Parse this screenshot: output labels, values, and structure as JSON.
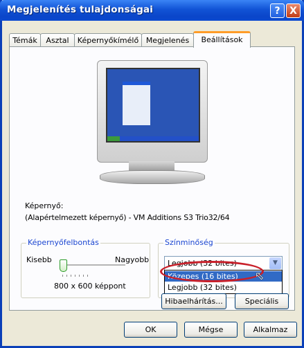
{
  "window": {
    "title": "Megjelenítés tulajdonságai"
  },
  "titlebar_buttons": {
    "help": "?",
    "close": "X"
  },
  "tabs": [
    {
      "label": "Témák"
    },
    {
      "label": "Asztal"
    },
    {
      "label": "Képernyőkímélő"
    },
    {
      "label": "Megjelenés"
    },
    {
      "label": "Beállítások",
      "active": true
    }
  ],
  "display": {
    "label": "Képernyő:",
    "value": "(Alapértelmezett képernyő) - VM Additions S3 Trio32/64"
  },
  "resolution": {
    "group_label": "Képernyőfelbontás",
    "less_label": "Kisebb",
    "more_label": "Nagyobb",
    "value": "800 x 600 képpont",
    "slider_level_fraction": 0.0
  },
  "color_quality": {
    "group_label": "Színminőség",
    "selected": "Legjobb (32 bites)",
    "options": [
      "Közepes (16 bites)",
      "Legjobb (32 bites)"
    ],
    "highlighted_option": "Közepes (16 bites)"
  },
  "buttons": {
    "troubleshoot": "Hibaelhárítás...",
    "advanced": "Speciális",
    "ok": "OK",
    "cancel": "Mégse",
    "apply": "Alkalmaz"
  },
  "colors": {
    "titlebar": "#0a45c9",
    "selection": "#316ac5",
    "annotation_circle": "#c8202a",
    "active_tab_accent": "#ff9c28"
  }
}
